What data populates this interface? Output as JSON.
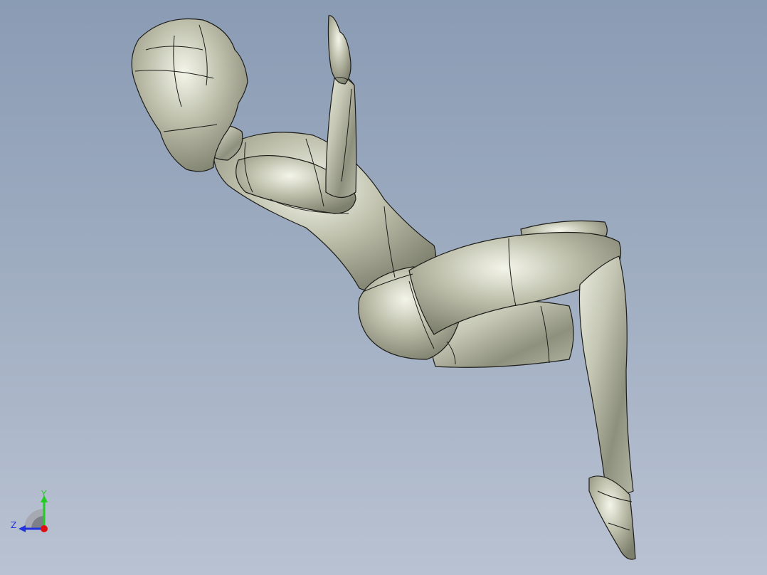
{
  "viewport": {
    "background_top": "#8a9bb4",
    "background_bottom": "#b9c2d2"
  },
  "model": {
    "surface_color": "#c7c9b8",
    "edge_color": "#1c1c18"
  },
  "triad": {
    "y_label": "Y",
    "z_label": "Z",
    "y_color": "#22cc22",
    "z_color": "#2233dd",
    "x_color": "#dd1111"
  }
}
